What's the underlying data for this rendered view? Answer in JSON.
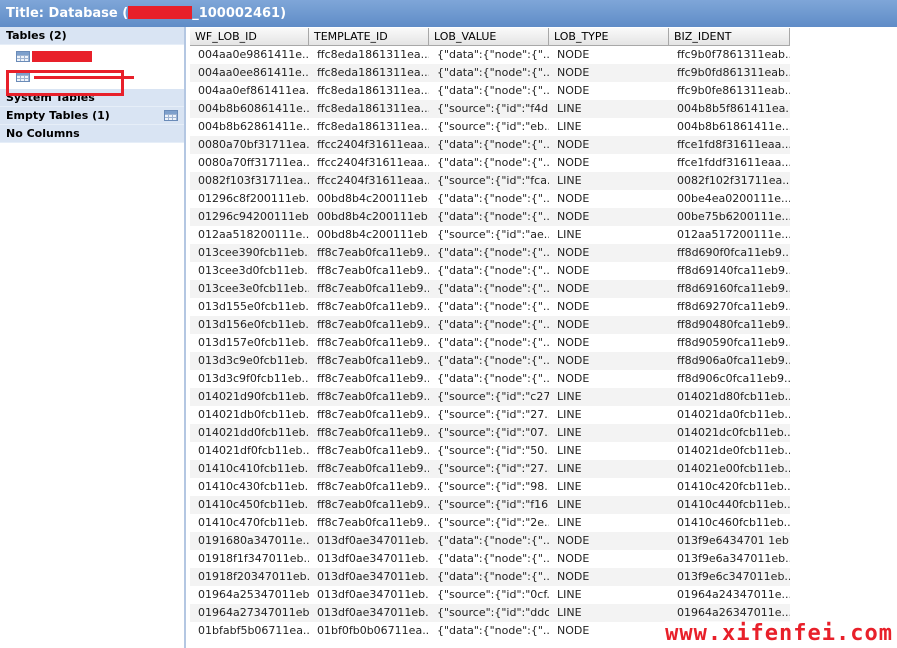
{
  "window": {
    "title_prefix": "Title: Database (",
    "title_suffix": "_100002461)"
  },
  "sidebar": {
    "tables_header": "Tables (2)",
    "system_tables": "System Tables",
    "empty_tables": "Empty Tables (1)",
    "no_columns": "No Columns"
  },
  "grid": {
    "columns": [
      "WF_LOB_ID",
      "TEMPLATE_ID",
      "LOB_VALUE",
      "LOB_TYPE",
      "BIZ_IDENT"
    ],
    "rows": [
      [
        "004aa0e9861411e...",
        "ffc8eda1861311ea...",
        "{\"data\":{\"node\":{\"...",
        "NODE",
        "ffc9b0f7861311eab..."
      ],
      [
        "004aa0ee861411e...",
        "ffc8eda1861311ea...",
        "{\"data\":{\"node\":{\"...",
        "NODE",
        "ffc9b0fd861311eab..."
      ],
      [
        "004aa0ef861411ea...",
        "ffc8eda1861311ea...",
        "{\"data\":{\"node\":{\"...",
        "NODE",
        "ffc9b0fe861311eab..."
      ],
      [
        "004b8b60861411e...",
        "ffc8eda1861311ea...",
        "{\"source\":{\"id\":\"f4d...",
        "LINE",
        "004b8b5f861411ea..."
      ],
      [
        "004b8b62861411e...",
        "ffc8eda1861311ea...",
        "{\"source\":{\"id\":\"eb...",
        "LINE",
        "004b8b61861411e..."
      ],
      [
        "0080a70bf31711ea...",
        "ffcc2404f31611eaa...",
        "{\"data\":{\"node\":{\"...",
        "NODE",
        "ffce1fd8f31611eaa..."
      ],
      [
        "0080a70ff31711ea...",
        "ffcc2404f31611eaa...",
        "{\"data\":{\"node\":{\"...",
        "NODE",
        "ffce1fddf31611eaa..."
      ],
      [
        "0082f103f31711ea...",
        "ffcc2404f31611eaa...",
        "{\"source\":{\"id\":\"fca...",
        "LINE",
        "0082f102f31711ea..."
      ],
      [
        "01296c8f200111eb...",
        "00bd8b4c200111eb...",
        "{\"data\":{\"node\":{\"...",
        "NODE",
        "00be4ea0200111e..."
      ],
      [
        "01296c94200111eb...",
        "00bd8b4c200111eb...",
        "{\"data\":{\"node\":{\"...",
        "NODE",
        "00be75b6200111e..."
      ],
      [
        "012aa518200111e...",
        "00bd8b4c200111eb...",
        "{\"source\":{\"id\":\"ae...",
        "LINE",
        "012aa517200111e..."
      ],
      [
        "013cee390fcb11eb...",
        "ff8c7eab0fca11eb9...",
        "{\"data\":{\"node\":{\"...",
        "NODE",
        "ff8d690f0fca11eb9..."
      ],
      [
        "013cee3d0fcb11eb...",
        "ff8c7eab0fca11eb9...",
        "{\"data\":{\"node\":{\"...",
        "NODE",
        "ff8d69140fca11eb9..."
      ],
      [
        "013cee3e0fcb11eb...",
        "ff8c7eab0fca11eb9...",
        "{\"data\":{\"node\":{\"...",
        "NODE",
        "ff8d69160fca11eb9..."
      ],
      [
        "013d155e0fcb11eb...",
        "ff8c7eab0fca11eb9...",
        "{\"data\":{\"node\":{\"...",
        "NODE",
        "ff8d69270fca11eb9..."
      ],
      [
        "013d156e0fcb11eb...",
        "ff8c7eab0fca11eb9...",
        "{\"data\":{\"node\":{\"...",
        "NODE",
        "ff8d90480fca11eb9..."
      ],
      [
        "013d157e0fcb11eb...",
        "ff8c7eab0fca11eb9...",
        "{\"data\":{\"node\":{\"...",
        "NODE",
        "ff8d90590fca11eb9..."
      ],
      [
        "013d3c9e0fcb11eb...",
        "ff8c7eab0fca11eb9...",
        "{\"data\":{\"node\":{\"...",
        "NODE",
        "ff8d906a0fca11eb9..."
      ],
      [
        "013d3c9f0fcb11eb...",
        "ff8c7eab0fca11eb9...",
        "{\"data\":{\"node\":{\"...",
        "NODE",
        "ff8d906c0fca11eb9..."
      ],
      [
        "014021d90fcb11eb...",
        "ff8c7eab0fca11eb9...",
        "{\"source\":{\"id\":\"c27...",
        "LINE",
        "014021d80fcb11eb..."
      ],
      [
        "014021db0fcb11eb...",
        "ff8c7eab0fca11eb9...",
        "{\"source\":{\"id\":\"27...",
        "LINE",
        "014021da0fcb11eb..."
      ],
      [
        "014021dd0fcb11eb...",
        "ff8c7eab0fca11eb9...",
        "{\"source\":{\"id\":\"07...",
        "LINE",
        "014021dc0fcb11eb..."
      ],
      [
        "014021df0fcb11eb...",
        "ff8c7eab0fca11eb9...",
        "{\"source\":{\"id\":\"50...",
        "LINE",
        "014021de0fcb11eb..."
      ],
      [
        "01410c410fcb11eb...",
        "ff8c7eab0fca11eb9...",
        "{\"source\":{\"id\":\"27...",
        "LINE",
        "014021e00fcb11eb..."
      ],
      [
        "01410c430fcb11eb...",
        "ff8c7eab0fca11eb9...",
        "{\"source\":{\"id\":\"98...",
        "LINE",
        "01410c420fcb11eb..."
      ],
      [
        "01410c450fcb11eb...",
        "ff8c7eab0fca11eb9...",
        "{\"source\":{\"id\":\"f16...",
        "LINE",
        "01410c440fcb11eb..."
      ],
      [
        "01410c470fcb11eb...",
        "ff8c7eab0fca11eb9...",
        "{\"source\":{\"id\":\"2e...",
        "LINE",
        "01410c460fcb11eb..."
      ],
      [
        "0191680a347011e...",
        "013df0ae347011eb...",
        "{\"data\":{\"node\":{\"...",
        "NODE",
        "013f9e6434701 1eb..."
      ],
      [
        "01918f1f347011eb...",
        "013df0ae347011eb...",
        "{\"data\":{\"node\":{\"...",
        "NODE",
        "013f9e6a347011eb..."
      ],
      [
        "01918f20347011eb...",
        "013df0ae347011eb...",
        "{\"data\":{\"node\":{\"...",
        "NODE",
        "013f9e6c347011eb..."
      ],
      [
        "01964a25347011eb...",
        "013df0ae347011eb...",
        "{\"source\":{\"id\":\"0cf...",
        "LINE",
        "01964a24347011e..."
      ],
      [
        "01964a27347011eb...",
        "013df0ae347011eb...",
        "{\"source\":{\"id\":\"ddc...",
        "LINE",
        "01964a26347011e..."
      ],
      [
        "01bfabf5b06711ea...",
        "01bf0fb0b06711ea...",
        "{\"data\":{\"node\":{\"...",
        "NODE",
        ""
      ]
    ]
  },
  "watermark": "www.xifenfei.com",
  "colors": {
    "accent": "#e8202a",
    "titlebar": "#6f98cf",
    "sidebar_header": "#d9e4f3"
  }
}
